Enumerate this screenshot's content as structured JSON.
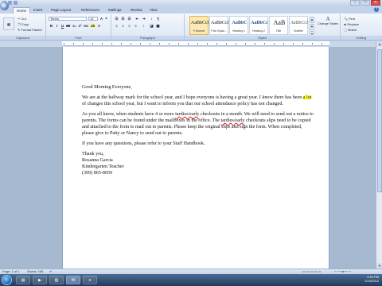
{
  "title_bar": {
    "title": "",
    "window_controls": [
      "–",
      "□",
      "✕"
    ]
  },
  "tabs": [
    "Home",
    "Insert",
    "Page Layout",
    "References",
    "Mailings",
    "Review",
    "View"
  ],
  "ribbon": {
    "clipboard": {
      "cut": "Cut",
      "copy": "Copy",
      "format_painter": "Format Painter",
      "label": "Clipboard"
    },
    "font": {
      "font_name": "Times",
      "font_size": "12",
      "label": "Font"
    },
    "paragraph": {
      "label": "Paragraph"
    },
    "styles": {
      "items": [
        {
          "sample": "AaBbCcI",
          "name": "¶ Normal"
        },
        {
          "sample": "AaBbCcI",
          "name": "¶ No Spaci..."
        },
        {
          "sample": "AaBbC",
          "name": "Heading 1"
        },
        {
          "sample": "AaBbCc",
          "name": "Heading 2"
        },
        {
          "sample": "AaB",
          "name": "Title"
        },
        {
          "sample": "AaBbCcI",
          "name": "Subtitle"
        }
      ],
      "change_styles": "Change Styles",
      "label": "Styles"
    },
    "editing": {
      "find": "Find",
      "replace": "Replace",
      "select": "Select",
      "label": "Editing"
    }
  },
  "document": {
    "greeting": "Good Morning Everyone,",
    "p1_a": "We are at the halfway mark for the school year, and I hope everyone is having a great year.  I know there has been ",
    "p1_highlight": "a lot",
    "p1_b": " of changes this school year, but I want to inform you that our school attendance policy has not changed.",
    "p2_a": "As you all know, when students have 4 or more ",
    "p2_squig": "tardies/early",
    "p2_b": " checkouts in a month.  We will need to send out a notice to parents. The forms can be found under the mailboxes in the office.  The ",
    "p2_squig2": "tardies/early",
    "p2_c": " checkouts slips need to be copied and attached to the form to mail out to parents. Please keep the original slips and sign the form.  When completed, please give to Patty or Nancy to send out to parents.",
    "p3": "If you have any questions, please refer to your Staff Handbook.",
    "signoff": "Thank you,\nRosanna Garcia\nKindergarten Teacher\n(309) 865-8059"
  },
  "status_bar": {
    "page": "Page: 1 of 1",
    "words": "Words: 165"
  },
  "taskbar": {
    "clock_time": "4:30 PM",
    "clock_date": "1/10/2012"
  }
}
